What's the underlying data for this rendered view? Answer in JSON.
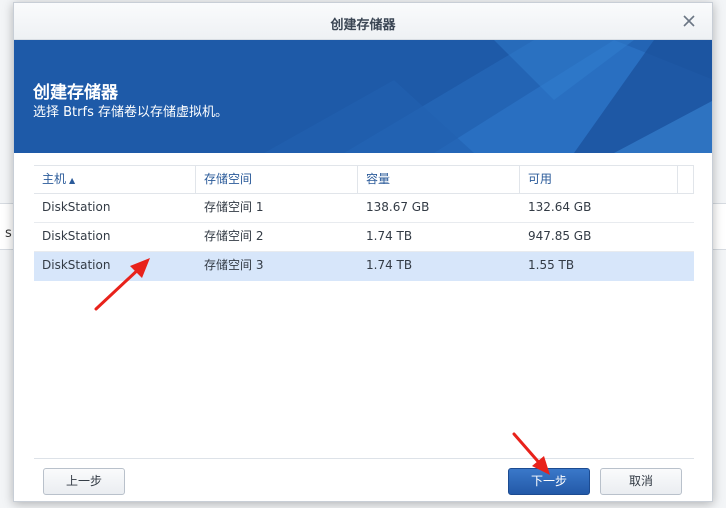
{
  "window": {
    "title": "创建存储器"
  },
  "banner": {
    "title": "创建存储器",
    "subtitle": "选择 Btrfs 存储卷以存储虚拟机。"
  },
  "table": {
    "columns": [
      "主机",
      "存储空间",
      "容量",
      "可用"
    ],
    "sort_indicator": "▲",
    "rows": [
      {
        "host": "DiskStation",
        "space": "存储空间 1",
        "capacity": "138.67 GB",
        "available": "132.64 GB"
      },
      {
        "host": "DiskStation",
        "space": "存储空间 2",
        "capacity": "1.74 TB",
        "available": "947.85 GB"
      },
      {
        "host": "DiskStation",
        "space": "存储空间 3",
        "capacity": "1.74 TB",
        "available": "1.55 TB"
      }
    ],
    "selected_row": 2
  },
  "footer": {
    "prev_label": "上一步",
    "next_label": "下一步",
    "cancel_label": "取消"
  },
  "background": {
    "glyph": "s"
  },
  "colors": {
    "banner": "#1e5aa8",
    "primary_button": "#2a65b5",
    "selected_row": "#d7e6fa",
    "arrow": "#e8221b"
  },
  "icons": [
    "close-icon",
    "sort-ascending-icon",
    "arrow-annotation-icon"
  ]
}
